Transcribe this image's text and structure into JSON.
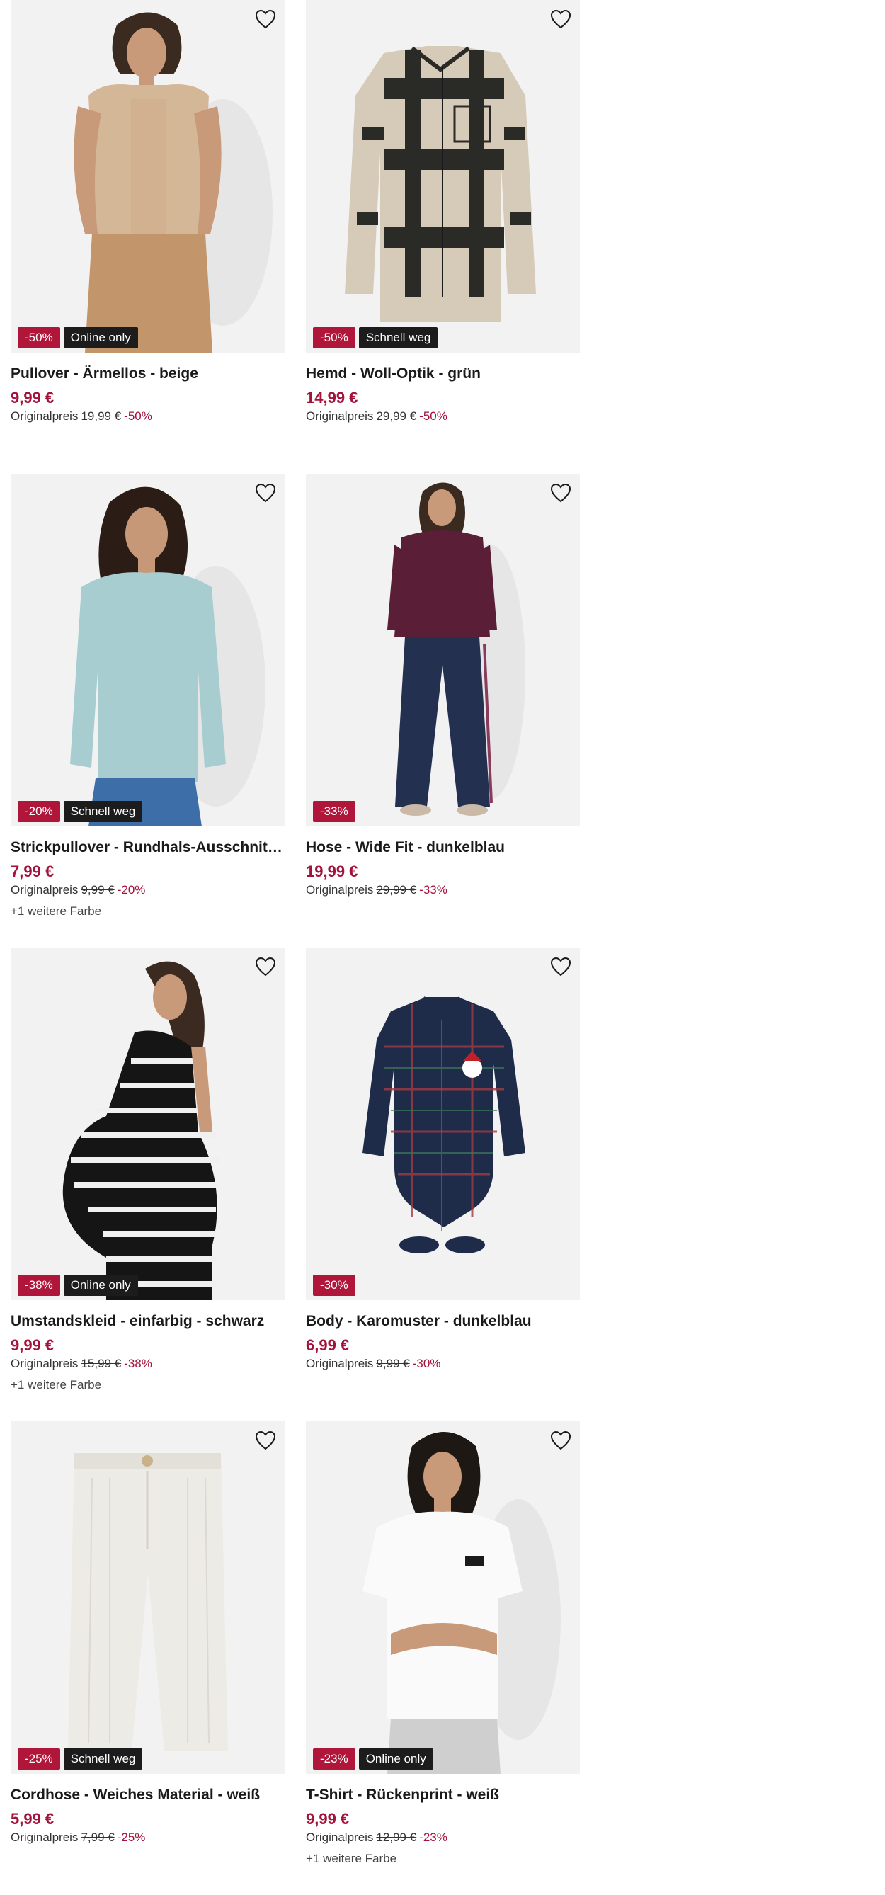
{
  "colors": {
    "discount": "#b0153a",
    "tag": "#1c1c1c",
    "price": "#a3123a",
    "image_bg": "#f2f2f2"
  },
  "products": [
    {
      "title": "Pullover - Ärmellos - beige",
      "price": "9,99 €",
      "original_label": "Originalpreis",
      "original_price": "19,99 €",
      "percent": "-50%",
      "discount_badge": "-50%",
      "tag_badge": "Online only",
      "more_colors": "",
      "art": "sweater-vest",
      "icon": "heart-icon"
    },
    {
      "title": "Hemd - Woll-Optik - grün",
      "price": "14,99 €",
      "original_label": "Originalpreis",
      "original_price": "29,99 €",
      "percent": "-50%",
      "discount_badge": "-50%",
      "tag_badge": "Schnell weg",
      "more_colors": "",
      "art": "plaid-shirt",
      "icon": "heart-icon"
    },
    {
      "title": "Strickpullover - Rundhals-Ausschnitt - tü...",
      "price": "7,99 €",
      "original_label": "Originalpreis",
      "original_price": "9,99 €",
      "percent": "-20%",
      "discount_badge": "-20%",
      "tag_badge": "Schnell weg",
      "more_colors": "+1 weitere Farbe",
      "art": "knit-sweater",
      "icon": "heart-icon"
    },
    {
      "title": "Hose - Wide Fit - dunkelblau",
      "price": "19,99 €",
      "original_label": "Originalpreis",
      "original_price": "29,99 €",
      "percent": "-33%",
      "discount_badge": "-33%",
      "tag_badge": "",
      "more_colors": "",
      "art": "wide-pants",
      "icon": "heart-icon"
    },
    {
      "title": "Umstandskleid - einfarbig - schwarz",
      "price": "9,99 €",
      "original_label": "Originalpreis",
      "original_price": "15,99 €",
      "percent": "-38%",
      "discount_badge": "-38%",
      "tag_badge": "Online only",
      "more_colors": "+1 weitere Farbe",
      "art": "maternity-dress",
      "icon": "heart-icon"
    },
    {
      "title": "Body - Karomuster - dunkelblau",
      "price": "6,99 €",
      "original_label": "Originalpreis",
      "original_price": "9,99 €",
      "percent": "-30%",
      "discount_badge": "-30%",
      "tag_badge": "",
      "more_colors": "",
      "art": "baby-body",
      "icon": "heart-icon"
    },
    {
      "title": "Cordhose - Weiches Material - weiß",
      "price": "5,99 €",
      "original_label": "Originalpreis",
      "original_price": "7,99 €",
      "percent": "-25%",
      "discount_badge": "-25%",
      "tag_badge": "Schnell weg",
      "more_colors": "",
      "art": "cord-pants",
      "icon": "heart-icon"
    },
    {
      "title": "T-Shirt - Rückenprint - weiß",
      "price": "9,99 €",
      "original_label": "Originalpreis",
      "original_price": "12,99 €",
      "percent": "-23%",
      "discount_badge": "-23%",
      "tag_badge": "Online only",
      "more_colors": "+1 weitere Farbe",
      "art": "t-shirt",
      "icon": "heart-icon"
    }
  ]
}
